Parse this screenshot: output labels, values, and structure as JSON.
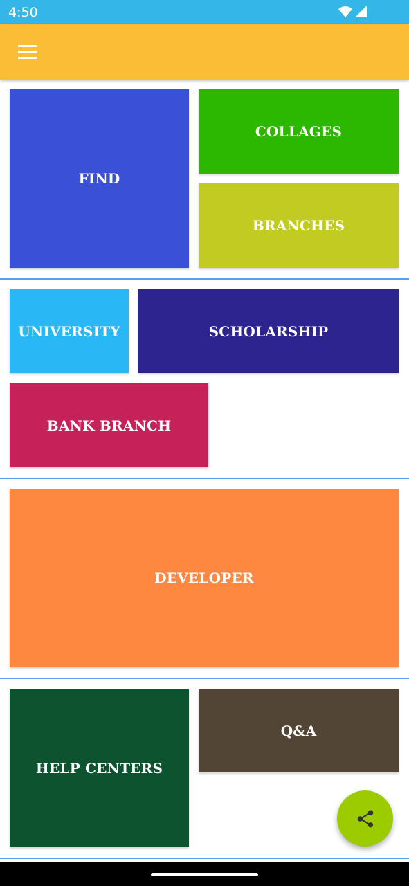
{
  "status_bar": {
    "time": "4:50",
    "icons": [
      "wifi-icon",
      "signal-icon"
    ],
    "color": "#35b6e8"
  },
  "app_bar": {
    "menu_icon": "hamburger-menu-icon",
    "color": "#fbbd35"
  },
  "tiles": {
    "find": {
      "label": "FIND",
      "color": "#3a50d6"
    },
    "collages": {
      "label": "COLLAGES",
      "color": "#2db800"
    },
    "branches": {
      "label": "BRANCHES",
      "color": "#c2cb22"
    },
    "university": {
      "label": "UNIVERSITY",
      "color": "#2ab7f6"
    },
    "scholarship": {
      "label": "SCHOLARSHIP",
      "color": "#2e248f"
    },
    "bank_branch": {
      "label": "BANK BRANCH",
      "color": "#c62158"
    },
    "developer": {
      "label": "DEVELOPER",
      "color": "#ff8840"
    },
    "help_centers": {
      "label": "HELP CENTERS",
      "color": "#0d5330"
    },
    "qa": {
      "label": "Q&A",
      "color": "#524535"
    }
  },
  "fab": {
    "icon": "share-icon",
    "color": "#9ccc00"
  },
  "divider_color": "#5b9df0"
}
